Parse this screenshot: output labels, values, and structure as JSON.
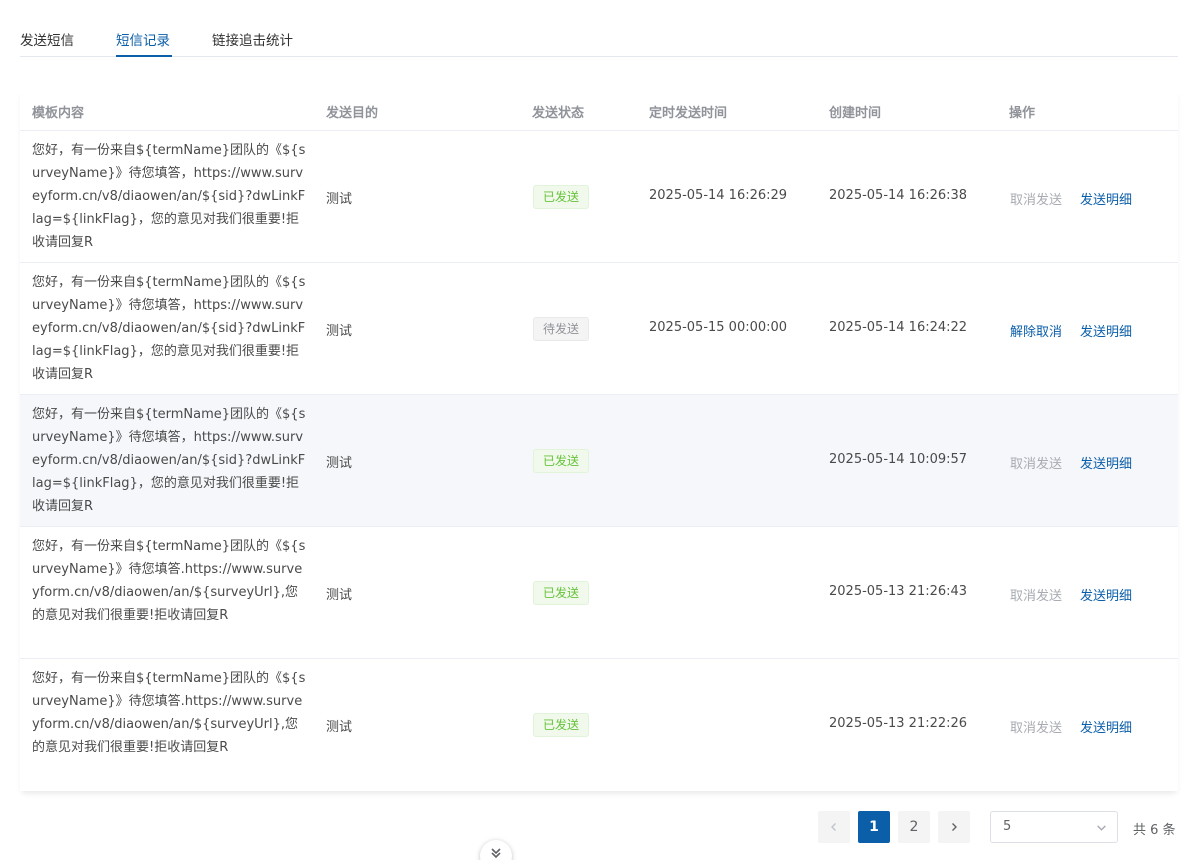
{
  "tabs": [
    {
      "label": "发送短信"
    },
    {
      "label": "短信记录"
    },
    {
      "label": "链接追击统计"
    }
  ],
  "table": {
    "headers": {
      "content": "模板内容",
      "target": "发送目的",
      "status": "发送状态",
      "scheduled": "定时发送时间",
      "created": "创建时间",
      "actions": "操作"
    },
    "rows": [
      {
        "content": "您好，有一份来自${termName}团队的《${surveyName}》待您填答，https://www.surveyform.cn/v8/diaowen/an/${sid}?dwLinkFlag=${linkFlag}，您的意见对我们很重要!拒收请回复R",
        "target": "测试",
        "status": "已发送",
        "scheduled": "2025-05-14 16:26:29",
        "created": "2025-05-14 16:26:38",
        "action1": "取消发送",
        "action2": "发送明细"
      },
      {
        "content": "您好，有一份来自${termName}团队的《${surveyName}》待您填答，https://www.surveyform.cn/v8/diaowen/an/${sid}?dwLinkFlag=${linkFlag}，您的意见对我们很重要!拒收请回复R",
        "target": "测试",
        "status": "待发送",
        "scheduled": "2025-05-15 00:00:00",
        "created": "2025-05-14 16:24:22",
        "action1": "解除取消",
        "action2": "发送明细"
      },
      {
        "content": "您好，有一份来自${termName}团队的《${surveyName}》待您填答，https://www.surveyform.cn/v8/diaowen/an/${sid}?dwLinkFlag=${linkFlag}，您的意见对我们很重要!拒收请回复R",
        "target": "测试",
        "status": "已发送",
        "scheduled": "",
        "created": "2025-05-14 10:09:57",
        "action1": "取消发送",
        "action2": "发送明细"
      },
      {
        "content": "您好，有一份来自${termName}团队的《${surveyName}》待您填答.https://www.surveyform.cn/v8/diaowen/an/${surveyUrl},您的意见对我们很重要!拒收请回复R",
        "target": "测试",
        "status": "已发送",
        "scheduled": "",
        "created": "2025-05-13 21:26:43",
        "action1": "取消发送",
        "action2": "发送明细"
      },
      {
        "content": "您好，有一份来自${termName}团队的《${surveyName}》待您填答.https://www.surveyform.cn/v8/diaowen/an/${surveyUrl},您的意见对我们很重要!拒收请回复R",
        "target": "测试",
        "status": "已发送",
        "scheduled": "",
        "created": "2025-05-13 21:22:26",
        "action1": "取消发送",
        "action2": "发送明细"
      }
    ]
  },
  "pagination": {
    "pages": [
      "1",
      "2"
    ],
    "current": "1",
    "page_size": "5",
    "total": "共 6 条"
  },
  "colors": {
    "primary": "#0b5ea8",
    "sent_tag": "#67c23a",
    "pending_tag": "#909399",
    "disabled_action": "#a8abb2"
  },
  "icons": {
    "prev": "chevron-left-icon",
    "next": "chevron-right-icon",
    "select": "chevron-down-icon",
    "float": "double-chevron-down-icon"
  }
}
